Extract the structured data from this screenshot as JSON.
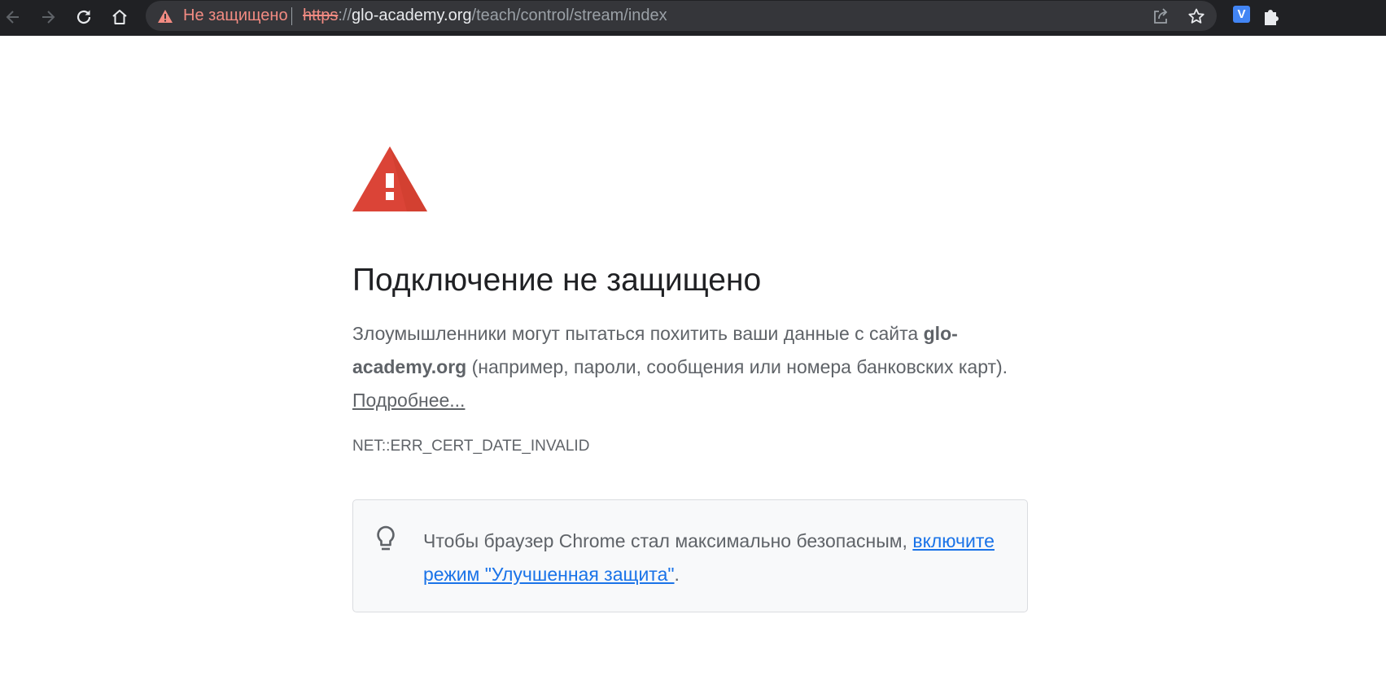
{
  "browser": {
    "security_label": "Не защищено",
    "url_scheme": "https",
    "url_separator": "://",
    "url_host": "glo-academy.org",
    "url_path": "/teach/control/stream/index",
    "extension_badge": "V",
    "icons": [
      "back-arrow-icon",
      "forward-arrow-icon",
      "reload-icon",
      "home-icon",
      "warning-icon",
      "share-icon",
      "star-icon",
      "puzzle-icon"
    ]
  },
  "interstitial": {
    "heading": "Подключение не защищено",
    "explanation_before": "Злоумышленники могут пытаться похитить ваши данные с сайта ",
    "explanation_host": "glo-academy.org",
    "explanation_after": " (например, пароли, сообщения или номера банковских карт). ",
    "learn_more": "Подробнее...",
    "error_code": "NET::ERR_CERT_DATE_INVALID",
    "promo_text": "Чтобы браузер Chrome стал максимально безопасным, ",
    "promo_link": "включите режим \"Улучшенная защита\"",
    "promo_end": "."
  },
  "colors": {
    "toolbar_bg": "#202124",
    "omnibox_bg": "#35363a",
    "danger_red": "#f28b82",
    "warning_icon_red": "#db4437",
    "link_blue": "#1a73e8",
    "text_gray": "#5f6368"
  }
}
